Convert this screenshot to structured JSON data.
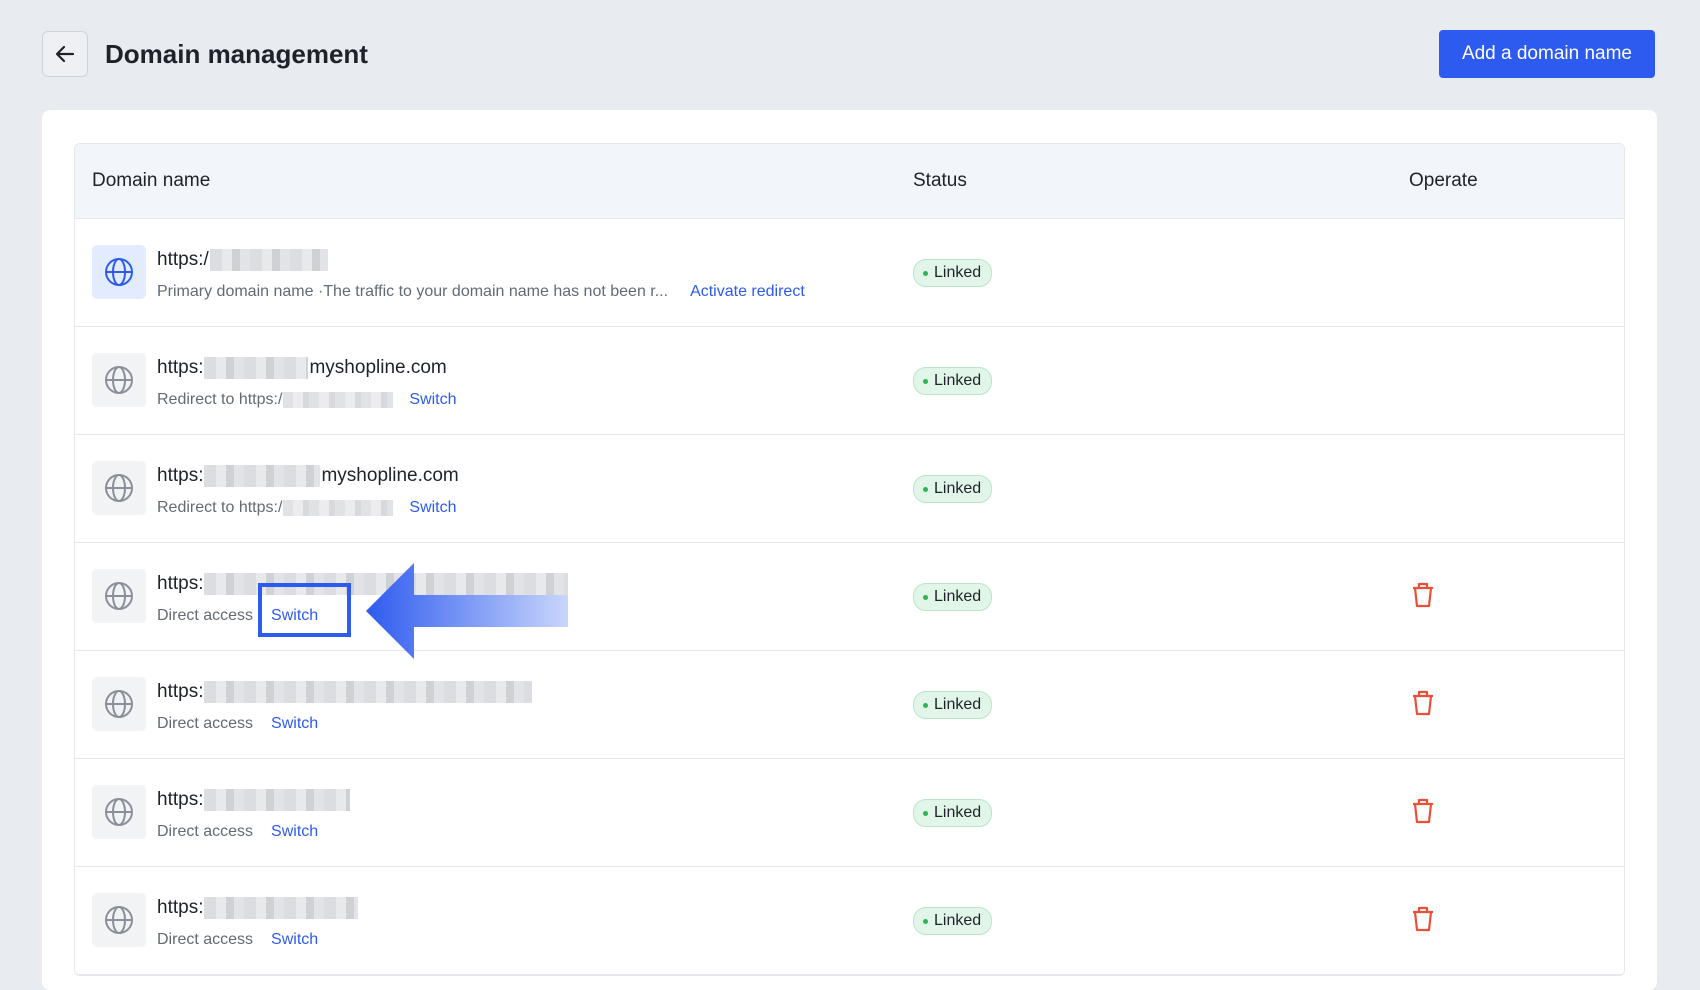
{
  "header": {
    "title": "Domain management",
    "add_button_label": "Add a domain name"
  },
  "table": {
    "columns": [
      "Domain name",
      "Status",
      "Operate"
    ],
    "rows": [
      {
        "domain_prefix": "https:/",
        "domain_suffix": "",
        "subtext": "Primary domain name ·The traffic to your domain name has not been r...",
        "action": "Activate redirect",
        "status": "Linked",
        "deletable": false,
        "primary": true
      },
      {
        "domain_prefix": "https:",
        "domain_suffix": "myshopline.com",
        "subtext": "Redirect to https:/",
        "action": "Switch",
        "status": "Linked",
        "deletable": false
      },
      {
        "domain_prefix": "https:",
        "domain_suffix": "myshopline.com",
        "subtext": "Redirect to https:/",
        "action": "Switch",
        "status": "Linked",
        "deletable": false
      },
      {
        "domain_prefix": "https:",
        "domain_suffix": "",
        "subtext": "Direct access",
        "action": "Switch",
        "status": "Linked",
        "deletable": true
      },
      {
        "domain_prefix": "https:",
        "domain_suffix": "",
        "subtext": "Direct access",
        "action": "Switch",
        "status": "Linked",
        "deletable": true
      },
      {
        "domain_prefix": "https:",
        "domain_suffix": "",
        "subtext": "Direct access",
        "action": "Switch",
        "status": "Linked",
        "deletable": true
      },
      {
        "domain_prefix": "https:",
        "domain_suffix": "",
        "subtext": "Direct access",
        "action": "Switch",
        "status": "Linked",
        "deletable": true
      }
    ]
  },
  "icons": {
    "back": "arrow-left-icon",
    "globe": "globe-icon",
    "trash": "trash-icon"
  },
  "colors": {
    "accent": "#2e5bef",
    "linked_badge_bg": "#e1f5e8",
    "linked_dot": "#2fb457",
    "delete": "#e8503a"
  }
}
